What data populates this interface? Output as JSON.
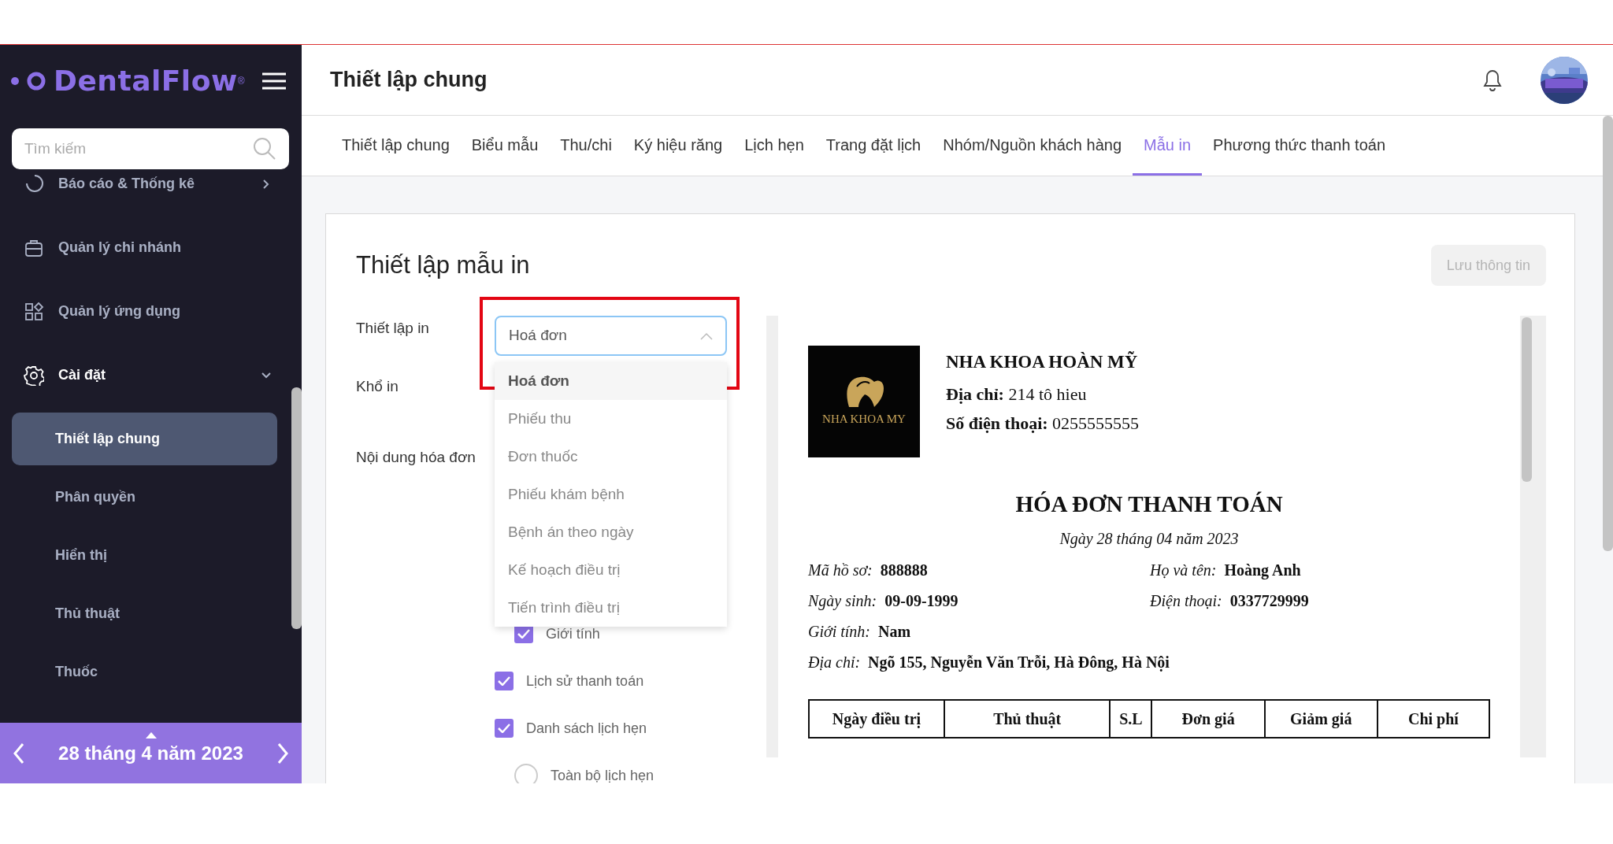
{
  "sidebar": {
    "logo": "DentalFlow",
    "logo_mark": "®",
    "search": {
      "placeholder": "Tìm kiếm"
    },
    "items": [
      {
        "label": "Báo cáo & Thống kê",
        "kind": "group",
        "expanded": false,
        "selected": false
      },
      {
        "label": "Quản lý chi nhánh",
        "kind": "link",
        "selected": false
      },
      {
        "label": "Quản lý ứng dụng",
        "kind": "link",
        "selected": false
      },
      {
        "label": "Cài đặt",
        "kind": "group",
        "expanded": true,
        "selected": true,
        "children": [
          {
            "label": "Thiết lập chung",
            "selected": true
          },
          {
            "label": "Phân quyền",
            "selected": false
          },
          {
            "label": "Hiển thị",
            "selected": false
          },
          {
            "label": "Thủ thuật",
            "selected": false
          },
          {
            "label": "Thuốc",
            "selected": false
          }
        ]
      }
    ],
    "date_nav": {
      "label": "28 tháng 4 năm 2023"
    }
  },
  "header": {
    "title": "Thiết lập chung"
  },
  "tabs": [
    {
      "label": "Thiết lập chung",
      "selected": false
    },
    {
      "label": "Biểu mẫu",
      "selected": false
    },
    {
      "label": "Thu/chi",
      "selected": false
    },
    {
      "label": "Ký hiệu răng",
      "selected": false
    },
    {
      "label": "Lịch hẹn",
      "selected": false
    },
    {
      "label": "Trang đặt lịch",
      "selected": false
    },
    {
      "label": "Nhóm/Nguồn khách hàng",
      "selected": false
    },
    {
      "label": "Mẫu in",
      "selected": true
    },
    {
      "label": "Phương thức thanh toán",
      "selected": false
    }
  ],
  "card": {
    "title": "Thiết lập mẫu in",
    "save_button": {
      "label": "Lưu thông tin",
      "disabled": true
    }
  },
  "form": {
    "labels": [
      "Thiết lập in",
      "Khổ in",
      "Nội dung hóa đơn"
    ],
    "select": {
      "value": "Hoá đơn",
      "expanded": true,
      "highlighted": true,
      "options": [
        {
          "label": "Hoá đơn",
          "selected": true
        },
        {
          "label": "Phiếu thu",
          "selected": false
        },
        {
          "label": "Đơn thuốc",
          "selected": false
        },
        {
          "label": "Phiếu khám bệnh",
          "selected": false
        },
        {
          "label": "Bệnh án theo ngày",
          "selected": false
        },
        {
          "label": "Kế hoạch điều trị",
          "selected": false
        },
        {
          "label": "Tiến trình điều trị",
          "selected": false
        }
      ]
    },
    "options": [
      {
        "label": "Giới tính",
        "kind": "subcheck",
        "checked": true
      },
      {
        "label": "Lịch sử thanh toán",
        "kind": "check",
        "checked": true
      },
      {
        "label": "Danh sách lịch hẹn",
        "kind": "check",
        "checked": true
      },
      {
        "label": "Toàn bộ lịch hẹn",
        "kind": "radio",
        "selected": false
      }
    ]
  },
  "invoice": {
    "logo_text": "NHA KHOA MY",
    "clinic_name": "NHA KHOA HOÀN MỸ",
    "address_label": "Địa chỉ:",
    "address": "214 tô hieu",
    "phone_label": "Số điện thoại:",
    "phone": "0255555555",
    "title": "HÓA ĐƠN THANH TOÁN",
    "date": "Ngày 28 tháng 04 năm 2023",
    "info": [
      [
        {
          "label": "Mã hồ sơ:",
          "value": "888888"
        },
        {
          "label": "Họ và tên:",
          "value": "Hoàng Anh"
        }
      ],
      [
        {
          "label": "Ngày sinh:",
          "value": "09-09-1999"
        },
        {
          "label": "Điện thoại:",
          "value": "0337729999"
        }
      ],
      [
        {
          "label": "Giới tính:",
          "value": "Nam"
        }
      ],
      [
        {
          "label": "Địa chỉ:",
          "value": "Ngõ 155, Nguyễn Văn Trỗi, Hà Đông, Hà Nội"
        }
      ]
    ],
    "table": {
      "columns": [
        "Ngày điều trị",
        "Thủ thuật",
        "S.L",
        "Đơn giá",
        "Giảm giá",
        "Chi phí"
      ]
    }
  }
}
